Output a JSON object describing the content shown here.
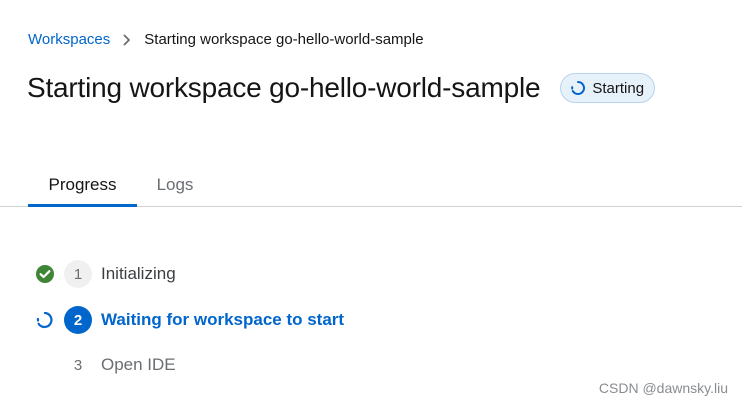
{
  "breadcrumb": {
    "root_link": "Workspaces",
    "current": "Starting workspace go-hello-world-sample"
  },
  "header": {
    "title": "Starting workspace go-hello-world-sample",
    "status_badge": "Starting"
  },
  "tabs": [
    {
      "label": "Progress",
      "active": true
    },
    {
      "label": "Logs",
      "active": false
    }
  ],
  "steps": [
    {
      "number": "1",
      "label": "Initializing",
      "state": "done",
      "icon": "check-circle-icon"
    },
    {
      "number": "2",
      "label": "Waiting for workspace to start",
      "state": "in-progress",
      "icon": "spinner-icon"
    },
    {
      "number": "3",
      "label": "Open IDE",
      "state": "pending",
      "icon": ""
    }
  ],
  "watermark": "CSDN @dawnsky.liu",
  "colors": {
    "accent": "#0066cc",
    "success": "#3e8635",
    "badge_bg": "#e7f1fa",
    "badge_border": "#b8d3ee",
    "muted_text": "#6a6e73"
  }
}
